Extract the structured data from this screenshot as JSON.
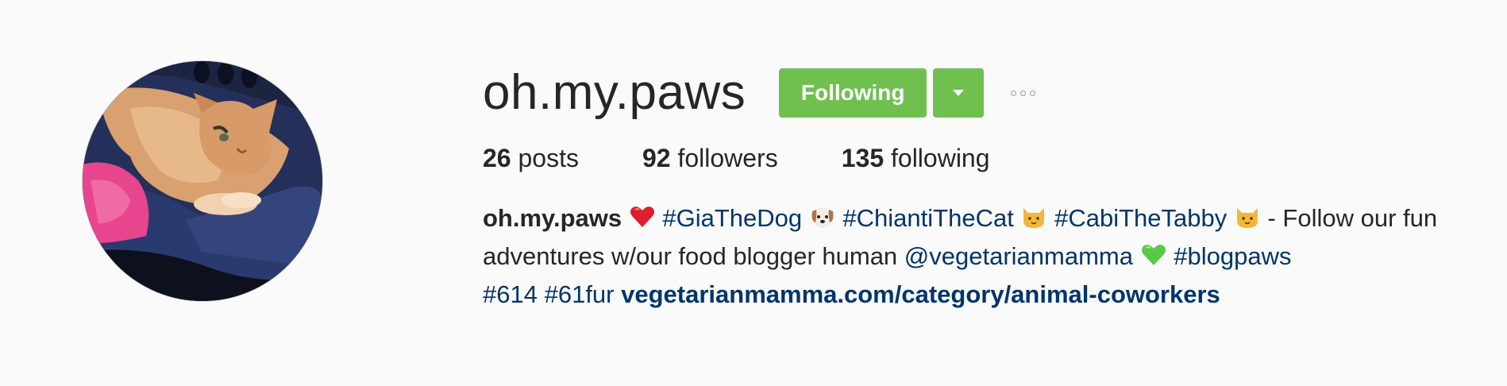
{
  "profile": {
    "username": "oh.my.paws",
    "following_label": "Following",
    "dropdown_icon": "caret-down-icon",
    "more_icon": "ellipsis-icon"
  },
  "stats": {
    "posts_count": "26",
    "posts_label": "posts",
    "followers_count": "92",
    "followers_label": "followers",
    "following_count": "135",
    "following_label": "following"
  },
  "bio": {
    "name": "oh.my.paws",
    "tag_gia": "#GiaTheDog",
    "tag_chianti": "#ChiantiTheCat",
    "tag_cabi": "#CabiTheTabby",
    "text_1": "- Follow our fun adventures w/our food blogger human",
    "mention": "@vegetarianmamma",
    "tag_blogpaws": "#blogpaws",
    "tag_614": "#614",
    "tag_61fur": "#61fur",
    "url": "vegetarianmamma.com/category/animal-coworkers"
  },
  "colors": {
    "following_button": "#70c050",
    "link": "#003569",
    "text": "#262626",
    "background": "#fafafa"
  }
}
